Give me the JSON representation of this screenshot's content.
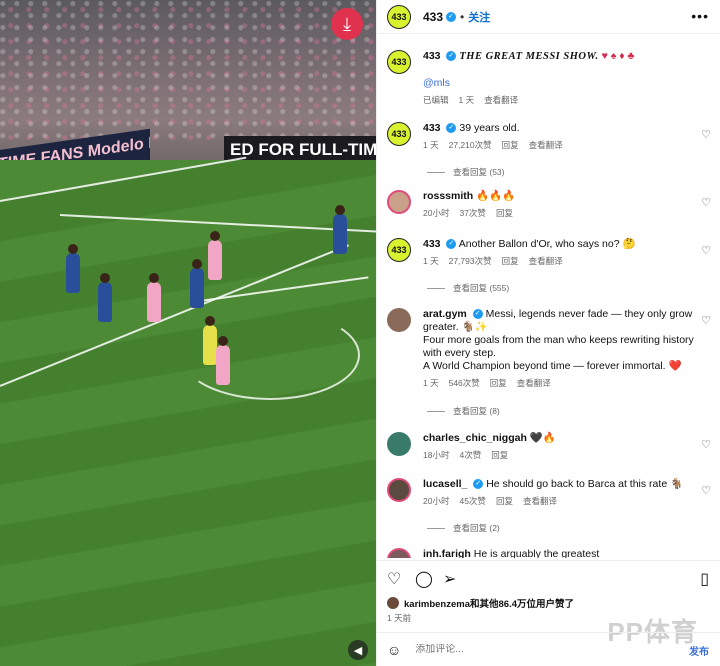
{
  "video": {
    "board_left": "TIME FANS  Modelo  BREW",
    "board_right": "ED FOR FULL-TIME FA",
    "download_icon": "download-icon",
    "mute_icon": "mute-icon"
  },
  "header": {
    "account": "433",
    "dot": "•",
    "follow": "关注",
    "more": "•••"
  },
  "caption": {
    "user": "433",
    "text": "THE GREAT MESSI SHOW.",
    "emojis": "♥ ♠ ♦ ♣",
    "mention": "@mls",
    "edited": "已编辑",
    "time": "1 天",
    "translate": "查看翻译"
  },
  "comments": [
    {
      "user": "433",
      "text": "39 years old.",
      "time": "1 天",
      "likes": "27,210次赞",
      "reply": "回复",
      "translate": "查看翻译",
      "replies": "查看回复 (53)"
    },
    {
      "user": "rosssmith",
      "text": "🔥🔥🔥",
      "time": "20小时",
      "likes": "37次赞",
      "reply": "回复"
    },
    {
      "user": "433",
      "text": "Another Ballon d'Or, who says no? 🤔",
      "time": "1 天",
      "likes": "27,793次赞",
      "reply": "回复",
      "translate": "查看翻译",
      "replies": "查看回复 (555)"
    },
    {
      "user": "arat.gym",
      "text": "Messi, legends never fade — they only grow greater. 🐐✨",
      "text2": "Four more goals from the man who keeps rewriting history with every step.",
      "text3": "A World Champion beyond time — forever immortal. ❤️",
      "time": "1 天",
      "likes": "546次赞",
      "reply": "回复",
      "translate": "查看翻译",
      "replies": "查看回复 (8)"
    },
    {
      "user": "charles_chic_niggah",
      "text": "🖤🔥",
      "time": "18小时",
      "likes": "4次赞",
      "reply": "回复"
    },
    {
      "user": "lucasell_",
      "text": "He should go back to Barca at this rate 🐐",
      "time": "20小时",
      "likes": "45次赞",
      "reply": "回复",
      "translate": "查看翻译",
      "replies": "查看回复 (2)"
    },
    {
      "user": "inh.farigh",
      "text": "He is arguably the greatest"
    }
  ],
  "footer": {
    "likes_text": "karimbenzema和其他86.4万位用户赞了",
    "time": "1 天前",
    "input_placeholder": "添加评论...",
    "post": "发布",
    "watermark": "PP体育"
  }
}
